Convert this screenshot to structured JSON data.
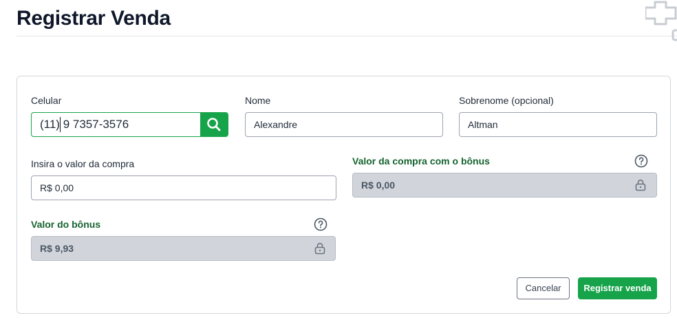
{
  "page": {
    "title": "Registrar Venda"
  },
  "form": {
    "phone": {
      "label": "Celular",
      "value": "(11) 9 7357-3576"
    },
    "first_name": {
      "label": "Nome",
      "value": "Alexandre"
    },
    "last_name": {
      "label": "Sobrenome (opcional)",
      "value": "Altman"
    },
    "purchase_value": {
      "label": "Insira o valor da compra",
      "value": "R$ 0,00"
    },
    "purchase_with_bonus": {
      "label": "Valor da compra com o bônus",
      "value": "R$ 0,00"
    },
    "bonus_value": {
      "label": "Valor do bônus",
      "value": "R$ 9,93"
    }
  },
  "actions": {
    "cancel_label": "Cancelar",
    "submit_label": "Registrar venda"
  },
  "icons": {
    "search": "search-icon",
    "help": "help-circle-icon",
    "lock": "lock-icon",
    "corner": "plus-outline-icon"
  },
  "colors": {
    "accent": "#16a34a",
    "label_green": "#15632f",
    "locked_bg": "#d1d5db"
  }
}
